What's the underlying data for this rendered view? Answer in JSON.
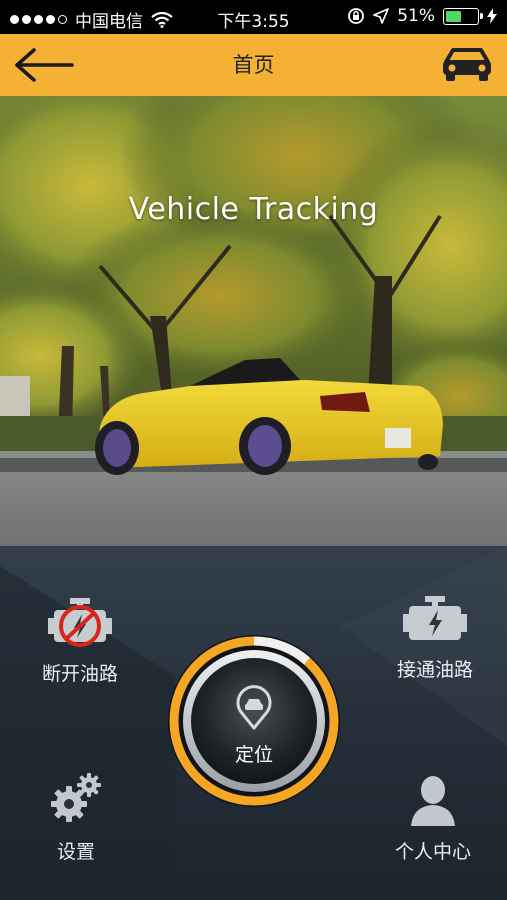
{
  "status_bar": {
    "carrier": "中国电信",
    "time": "下午3:55",
    "battery": "51%",
    "battery_level": 0.51
  },
  "nav": {
    "title": "首页",
    "back_icon": "back-arrow-icon",
    "right_icon": "car-icon"
  },
  "hero": {
    "banner_text": "Vehicle Tracking"
  },
  "controls": {
    "cut_oil": "断开油路",
    "connect_oil": "接通油路",
    "locate": "定位",
    "settings": "设置",
    "profile": "个人中心"
  },
  "colors": {
    "accent": "#f5b133",
    "panel": "#26313b",
    "warn_red": "#d9261c"
  }
}
